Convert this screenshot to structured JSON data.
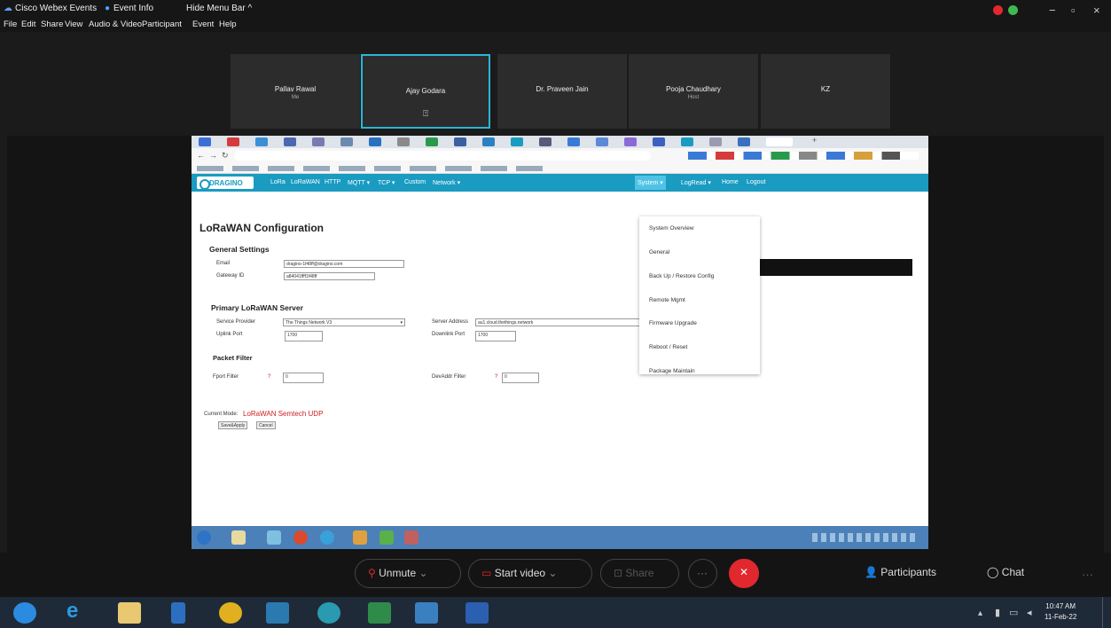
{
  "topbar": {
    "app": "Cisco Webex Events",
    "event_info": "Event Info",
    "hide_menu": "Hide Menu Bar ^"
  },
  "menu": [
    "File",
    "Edit",
    "Share",
    "View",
    "Audio & Video",
    "Participant",
    "Event",
    "Help"
  ],
  "participants": [
    {
      "name": "Pallav Rawal",
      "sub": "Me"
    },
    {
      "name": "Ajay Godara",
      "sub": ""
    },
    {
      "name": "Dr. Praveen Jain",
      "sub": ""
    },
    {
      "name": "Pooja Chaudhary",
      "sub": "Host"
    },
    {
      "name": "KZ",
      "sub": ""
    }
  ],
  "nav": {
    "logo": "DRAGINO",
    "items": [
      "LoRa",
      "LoRaWAN",
      "HTTP",
      "MQTT ▾",
      "TCP ▾",
      "Custom",
      "Network ▾",
      "System ▾",
      "LogRead ▾",
      "Home",
      "Logout"
    ]
  },
  "page": {
    "title": "LoRaWAN Configuration",
    "general": "General Settings",
    "email_label": "Email",
    "email_value": "dragino-1f48ff@dragino.com",
    "gateway_label": "Gateway ID",
    "gateway_value": "a84041ffff1f48ff",
    "primary": "Primary LoRaWAN Server",
    "provider_label": "Service Provider",
    "provider_value": "The Things Network V3",
    "server_label": "Server Address",
    "server_value": "au1.cloud.thethings.network",
    "uplink_label": "Uplink Port",
    "uplink_value": "1700",
    "downlink_label": "Downlink Port",
    "downlink_value": "1700",
    "packet_filter": "Packet Filter",
    "fport_label": "Fport Filter",
    "fport_value": "0",
    "devaddr_label": "DevAddr Filter",
    "devaddr_value": "0",
    "mode_label": "Current Mode:",
    "mode_value": "LoRaWAN Semtech UDP",
    "save": "Save&Apply",
    "cancel": "Cancel"
  },
  "dropdown": [
    "System Overview",
    "General",
    "Back Up / Restore Config",
    "Remote Mgmt",
    "Firmware Upgrade",
    "Reboot / Reset",
    "Package Maintain"
  ],
  "controls": {
    "unmute": "Unmute",
    "start_video": "Start video",
    "share": "Share",
    "participants": "Participants",
    "chat": "Chat"
  },
  "clock": {
    "time": "10:47 AM",
    "date": "11-Feb-22"
  },
  "colors": {
    "accent": "#1a9bc1",
    "end_call": "#e0282e",
    "mode_red": "#cc1f1f"
  }
}
